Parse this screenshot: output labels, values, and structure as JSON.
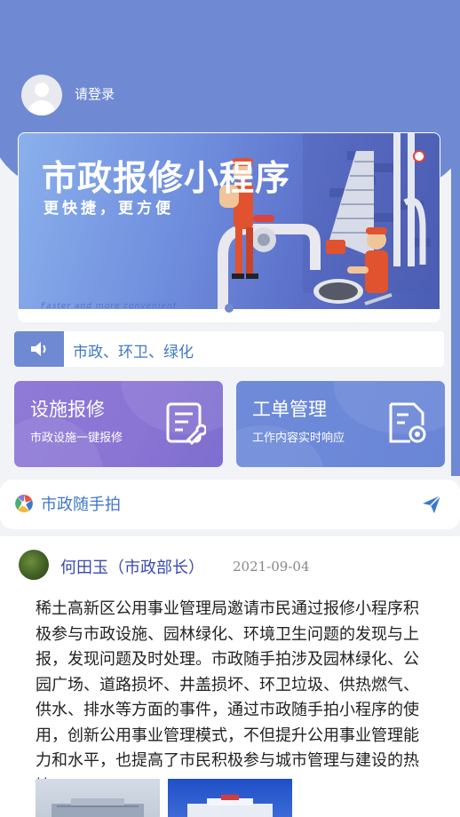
{
  "header": {
    "login_text": "请登录"
  },
  "banner": {
    "title": "市政报修小程序",
    "subtitle": "更快捷，更方便",
    "footer": "Faster and more convenient",
    "indicator_count": 1
  },
  "notice": {
    "text": "市政、环卫、绿化"
  },
  "cards": [
    {
      "title": "设施报修",
      "subtitle": "市政设施一键报修",
      "icon": "repair-form-icon"
    },
    {
      "title": "工单管理",
      "subtitle": "工作内容实时响应",
      "icon": "document-settings-icon"
    }
  ],
  "section": {
    "title": "市政随手拍"
  },
  "post": {
    "author": "何田玉（市政部长）",
    "date": "2021-09-04",
    "body": "稀土高新区公用事业管理局邀请市民通过报修小程序积极参与市政设施、园林绿化、环境卫生问题的发现与上报，发现问题及时处理。市政随手拍涉及园林绿化、公园广场、道路损坏、井盖损坏、环卫垃圾、供热燃气、供水、排水等方面的事件，通过市政随手拍小程序的使用，创新公用事业管理模式，不但提升公用事业管理能力和水平，也提高了市民积极参与城市管理与建设的热情。"
  },
  "colors": {
    "primary": "#6f89d3",
    "link": "#3e78c8",
    "card_a": "#8a74d4",
    "card_b": "#6a85d6",
    "author": "#3a4bad"
  }
}
